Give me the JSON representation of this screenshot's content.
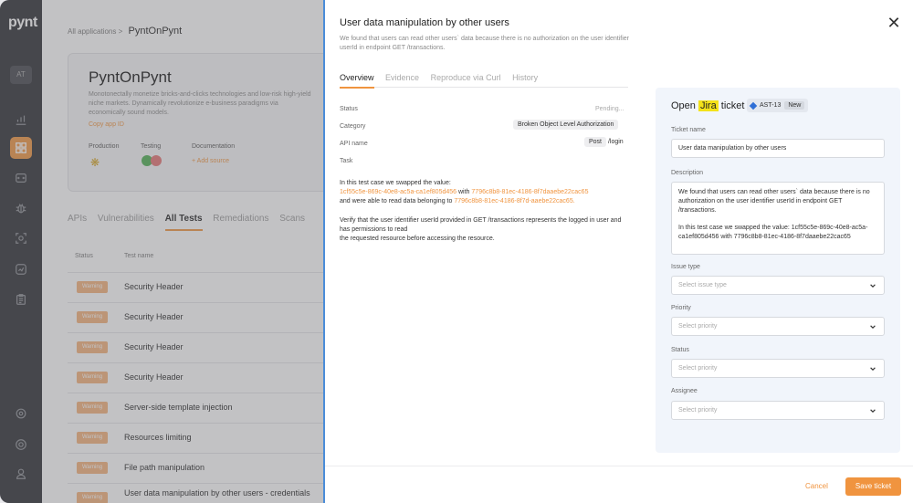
{
  "sidebar": {
    "logo_text": "pynt",
    "workspace_initials": "AT",
    "active_item": "dashboard",
    "accent_color": "#f0943f"
  },
  "background": {
    "breadcrumb_root": "All applications",
    "breadcrumb_sep": ">",
    "breadcrumb_current": "PyntOnPynt",
    "app_title": "PyntOnPynt",
    "app_description": "Monotonectally monetize bricks-and-clicks technologies and low-risk high-yield niche markets. Dynamically revolutionize e-business paradigms via economically sound models.",
    "copy_app_id": "Copy app ID",
    "production_label": "Production",
    "testing_label": "Testing",
    "documentation_label": "Documentation",
    "add_source": "+ Add source",
    "tabs": [
      "APIs",
      "Vulnerabilities",
      "All Tests",
      "Remediations",
      "Scans"
    ],
    "active_tab": "All Tests",
    "col_status": "Status",
    "col_test_name": "Test name",
    "badge_text": "Warning",
    "rows": [
      "Security Header",
      "Security Header",
      "Security Header",
      "Security Header",
      "Server-side template injection",
      "Resources limiting",
      "File path manipulation",
      "User data manipulation by other users - credentials"
    ]
  },
  "modal": {
    "title": "User data manipulation by other users",
    "description": "We found that users can read other users` data because there is no authorization on the user identifier userId in endpoint GET /transactions.",
    "tabs": [
      "Overview",
      "Evidence",
      "Reproduce via Curl",
      "History"
    ],
    "active_tab": "Overview",
    "status_label": "Status",
    "status_value": "Pending...",
    "category_label": "Category",
    "category_value": "Broken Object Level Authorization",
    "api_label": "API name",
    "api_method": "Post",
    "api_path": "/login",
    "task_label": "Task",
    "body_intro": "In this test case we swapped the value:",
    "value_a": "1cf55c5e-869c-40e8-ac5a-ca1ef805d456",
    "with_text": "with",
    "value_b": "7796c8b8-81ec-4186-8f7daaebe22cac65",
    "read_text": "and were able to read data belonging to",
    "value_c": "7796c8b8-81ec-4186-8f7d-aaebe22cac65.",
    "verify_text_1": "Verify that the user identifier userId provided in GET /transactions represents the logged in user and has permissions to read",
    "verify_text_2": "the requested resource before accessing the resource."
  },
  "jira": {
    "title_prefix": "Open",
    "title_brand": "Jira",
    "title_suffix": "ticket",
    "ticket_id": "AST-13",
    "ticket_state": "New",
    "ticket_name_label": "Ticket name",
    "ticket_name_value": "User data manipulation by other users",
    "description_label": "Description",
    "description_p1": "We found that users can read other users` data because there is no authorization on the user identifier userId in endpoint GET /transactions.",
    "description_p2": "In this test case we swapped the value: 1cf55c5e-869c-40e8-ac5a-ca1ef805d456 with 7796c8b8-81ec-4186-8f7daaebe22cac65",
    "issue_type_label": "Issue type",
    "issue_type_placeholder": "Select issue type",
    "priority_label": "Priority",
    "priority_placeholder": "Select priority",
    "status_label": "Status",
    "status_placeholder": "Select priority",
    "assignee_label": "Assignee",
    "assignee_placeholder": "Select priority"
  },
  "footer": {
    "cancel_label": "Cancel",
    "save_label": "Save ticket"
  }
}
